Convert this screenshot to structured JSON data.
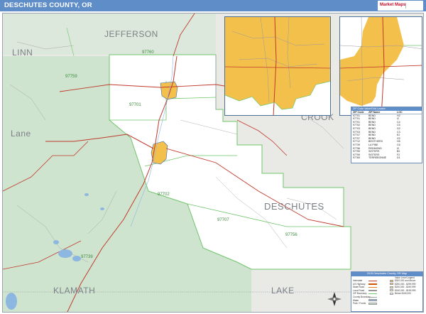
{
  "header": {
    "title": "DESCHUTES COUNTY, OR",
    "bar_color": "#5f8dc8",
    "logo_mark": "Market Maps",
    "logo_icon": "brand-logo-icon"
  },
  "map": {
    "colors": {
      "county_fill": "#ffffff",
      "outside_fill": "#e9eae6",
      "forest_fill": "#cfe4cf",
      "zip_highlight": "#f4c04c",
      "water": "#8db7e0",
      "highway": "#c0392b",
      "zip_boundary": "#6fc56a",
      "county_boundary": "#9aa3ad"
    },
    "region_labels": {
      "jefferson": "JEFFERSON",
      "linn": "LINN",
      "lane": "Lane",
      "crook": "CROOK",
      "deschutes": "DESCHUTES",
      "klamath": "KLAMATH",
      "lake": "LAKE"
    },
    "zip_labels": [
      "97760",
      "97759",
      "97701",
      "97707",
      "97739",
      "97756",
      "97702"
    ]
  },
  "zip_table": {
    "heading": "ZIP Code Value/Grid Locator",
    "columns": [
      "ZIP Code",
      "ZIP Name",
      "LOC"
    ],
    "rows": [
      [
        "97701",
        "BEND",
        "H2"
      ],
      [
        "97701",
        "BEND",
        "I2"
      ],
      [
        "97701",
        "BEND",
        "C4"
      ],
      [
        "97702",
        "BEND",
        "C5"
      ],
      [
        "97703",
        "BEND",
        "G2"
      ],
      [
        "97703",
        "BEND",
        "C3"
      ],
      [
        "97707",
        "BEND",
        "E2"
      ],
      [
        "97707",
        "BEND",
        "G2"
      ],
      [
        "97712",
        "BROTHERS",
        "H5"
      ],
      [
        "97739",
        "LA PINE",
        "C6"
      ],
      [
        "97756",
        "REDMOND",
        "I2"
      ],
      [
        "97759",
        "SISTERS",
        "B2"
      ],
      [
        "97759",
        "SISTERS",
        "F2"
      ],
      [
        "97760",
        "TERREBONNE",
        "D1"
      ]
    ]
  },
  "legend": {
    "heading": "2015 Deschutes County, OR Map",
    "subheading": "Value Level Legend",
    "items": [
      {
        "label": "Interstate",
        "color": "#c0392b",
        "kind": "line"
      },
      {
        "label": "US Highway",
        "color": "#d35400",
        "kind": "line"
      },
      {
        "label": "State Road",
        "color": "#e67e22",
        "kind": "line"
      },
      {
        "label": "Local Road",
        "color": "#999999",
        "kind": "line"
      },
      {
        "label": "ZIP Boundary",
        "color": "#6fc56a",
        "kind": "line"
      },
      {
        "label": "County Boundary",
        "color": "#9aa3ad",
        "kind": "line"
      },
      {
        "label": "Water",
        "color": "#8db7e0",
        "kind": "box"
      },
      {
        "label": "Park / Forest",
        "color": "#cfe4cf",
        "kind": "box"
      }
    ],
    "right_items": [
      {
        "label": "$300,000 and Above",
        "color": "#f4c04c"
      },
      {
        "label": "$250,000 - $299,999",
        "color": "#f7d57e"
      },
      {
        "label": "$200,000 - $249,999",
        "color": "#fae3a8"
      },
      {
        "label": "$150,000 - $199,999",
        "color": "#fcefcf"
      },
      {
        "label": "Below $150,000",
        "color": "#ffffff"
      }
    ],
    "north_icon": "north-arrow-icon"
  }
}
